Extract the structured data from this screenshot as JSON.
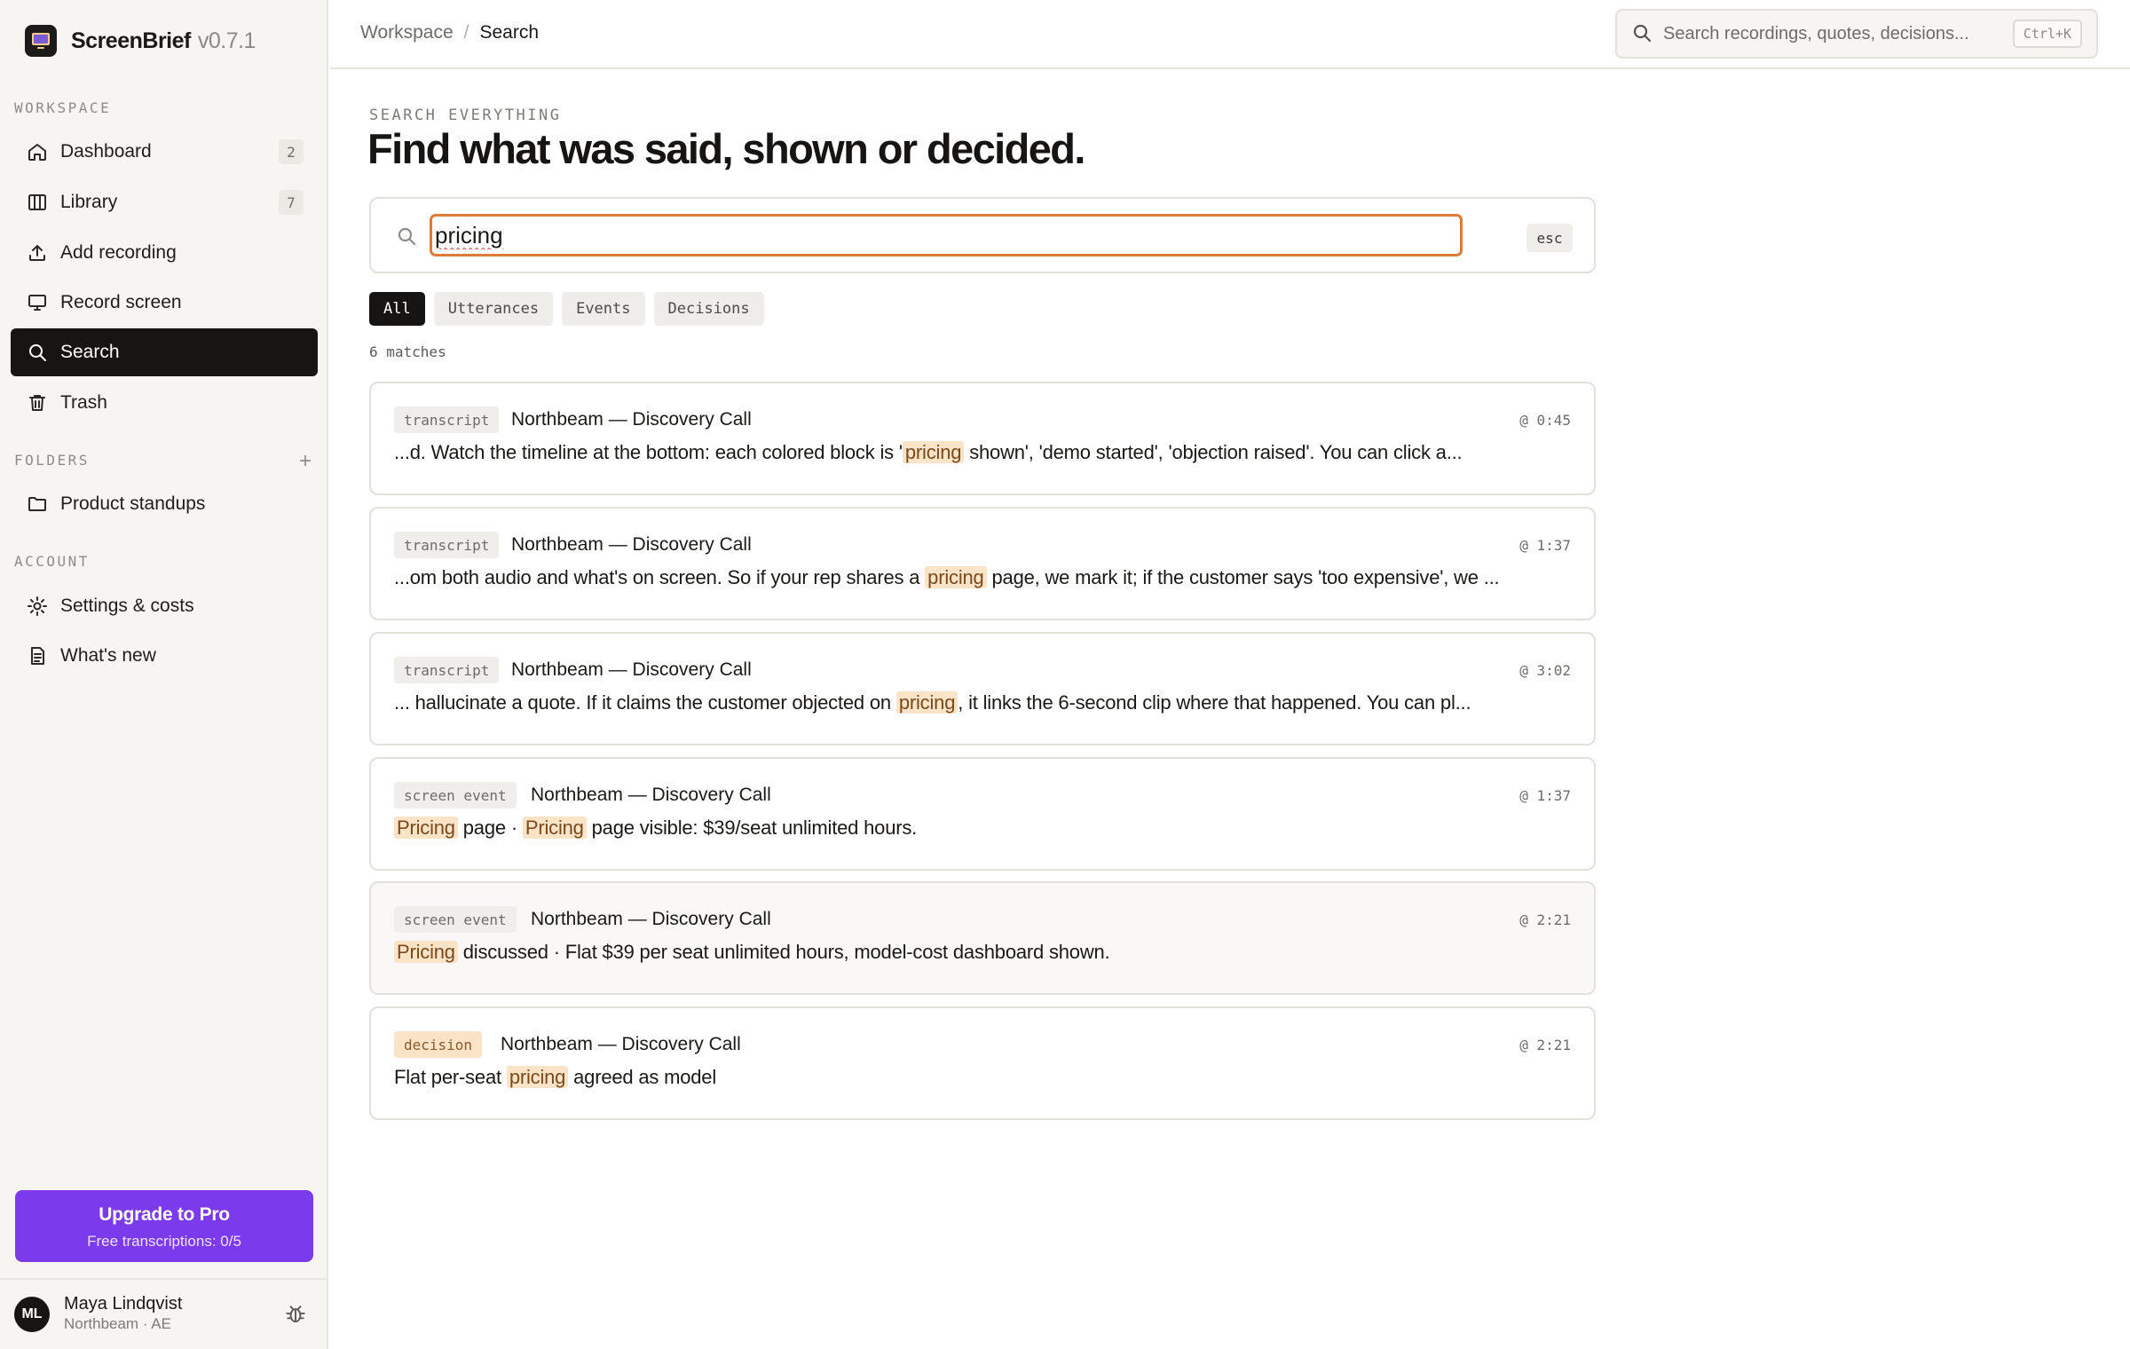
{
  "app": {
    "name": "ScreenBrief",
    "version": "v0.7.1"
  },
  "sidebar": {
    "workspace_label": "WORKSPACE",
    "items": [
      {
        "label": "Dashboard",
        "count": "2"
      },
      {
        "label": "Library",
        "count": "7"
      },
      {
        "label": "Add recording"
      },
      {
        "label": "Record screen"
      },
      {
        "label": "Search"
      },
      {
        "label": "Trash"
      }
    ],
    "folders_label": "FOLDERS",
    "folders": [
      {
        "label": "Product standups"
      }
    ],
    "account_label": "ACCOUNT",
    "account_items": [
      {
        "label": "Settings & costs"
      },
      {
        "label": "What's new"
      }
    ],
    "upgrade": {
      "title": "Upgrade to Pro",
      "subtitle": "Free transcriptions: 0/5"
    },
    "user": {
      "initials": "ML",
      "name": "Maya Lindqvist",
      "subtitle": "Northbeam · AE"
    }
  },
  "header": {
    "breadcrumb": [
      "Workspace",
      "Search"
    ],
    "separator": "/",
    "search_placeholder": "Search recordings, quotes, decisions...",
    "search_shortcut": "Ctrl+K"
  },
  "main": {
    "eyebrow": "SEARCH EVERYTHING",
    "title": "Find what was said, shown or decided.",
    "query": "pricing",
    "esc_label": "esc",
    "filters": [
      "All",
      "Utterances",
      "Events",
      "Decisions"
    ],
    "active_filter": "All",
    "match_count": "6 matches",
    "results": [
      {
        "type": "transcript",
        "title": "Northbeam — Discovery Call",
        "time": "@ 0:45",
        "snippet": [
          {
            "t": "...d. Watch the timeline at the bottom: each colored block is '"
          },
          {
            "t": "pricing",
            "hl": true
          },
          {
            "t": " shown', 'demo started', 'objection raised'. You can click a..."
          }
        ]
      },
      {
        "type": "transcript",
        "title": "Northbeam — Discovery Call",
        "time": "@ 1:37",
        "snippet": [
          {
            "t": "...om both audio and what's on screen. So if your rep shares a "
          },
          {
            "t": "pricing",
            "hl": true
          },
          {
            "t": " page, we mark it; if the customer says 'too expensive', we ..."
          }
        ]
      },
      {
        "type": "transcript",
        "title": "Northbeam — Discovery Call",
        "time": "@ 3:02",
        "snippet": [
          {
            "t": "... hallucinate a quote. If it claims the customer objected on "
          },
          {
            "t": "pricing",
            "hl": true
          },
          {
            "t": ", it links the 6-second clip where that happened. You can pl..."
          }
        ]
      },
      {
        "type": "screen event",
        "title": "Northbeam — Discovery Call",
        "time": "@ 1:37",
        "snippet": [
          {
            "t": "Pricing",
            "hl": true
          },
          {
            "t": " page · "
          },
          {
            "t": "Pricing",
            "hl": true
          },
          {
            "t": " page visible: $39/seat unlimited hours."
          }
        ]
      },
      {
        "type": "screen event",
        "title": "Northbeam — Discovery Call",
        "time": "@ 2:21",
        "snippet": [
          {
            "t": "Pricing",
            "hl": true
          },
          {
            "t": " discussed · Flat $39 per seat unlimited hours, model-cost dashboard shown."
          }
        ]
      },
      {
        "type": "decision",
        "title": "Northbeam — Discovery Call",
        "time": "@ 2:21",
        "snippet": [
          {
            "t": "Flat per-seat "
          },
          {
            "t": "pricing",
            "hl": true
          },
          {
            "t": " agreed as model"
          }
        ]
      }
    ]
  },
  "colors": {
    "accent": "#7c3aed",
    "highlight": "#fbe3c8",
    "focus_ring": "#e07b39",
    "active_nav": "#161513"
  }
}
